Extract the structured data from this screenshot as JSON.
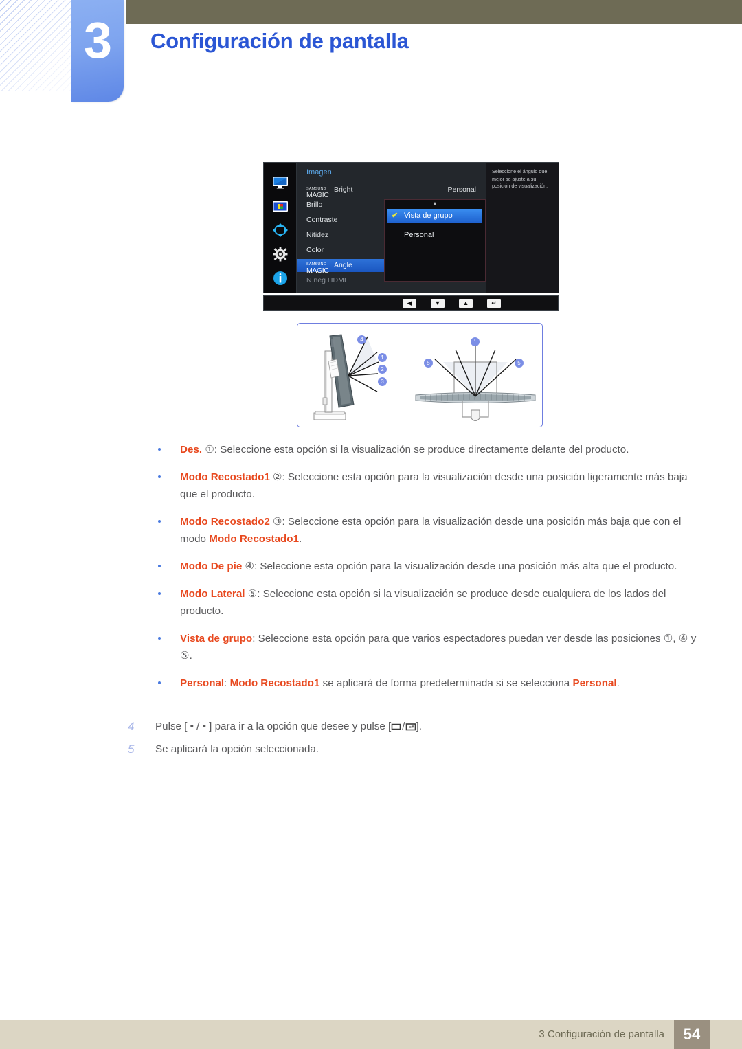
{
  "header": {
    "chapter_number": "3",
    "title": "Configuración de pantalla"
  },
  "osd": {
    "heading": "Imagen",
    "sidebar_icons": [
      "monitor-icon",
      "picture-icon",
      "arrows-icon",
      "gear-icon",
      "info-icon"
    ],
    "menu_items": [
      {
        "samsung": "SAMSUNG",
        "magic": "MAGIC",
        "label": "Bright",
        "state": "normal"
      },
      {
        "label": "Brillo",
        "state": "normal"
      },
      {
        "label": "Contraste",
        "state": "normal"
      },
      {
        "label": "Nitidez",
        "state": "normal"
      },
      {
        "label": "Color",
        "state": "normal"
      },
      {
        "samsung": "SAMSUNG",
        "magic": "MAGIC",
        "label": "Angle",
        "state": "selected"
      },
      {
        "label": "N.neg HDMI",
        "state": "disabled"
      }
    ],
    "bright_value": "Personal",
    "help_text": "Seleccione el ángulo que mejor se ajuste a su posición de visualización.",
    "submenu": {
      "up_arrow": "▲",
      "options": [
        {
          "label": "Vista de grupo",
          "checked": true
        },
        {
          "label": "Personal",
          "checked": false
        }
      ],
      "check_glyph": "✔"
    },
    "toolbar_buttons": [
      {
        "name": "back-button",
        "glyph": "◀"
      },
      {
        "name": "down-button",
        "glyph": "▼"
      },
      {
        "name": "up-button",
        "glyph": "▲"
      },
      {
        "name": "enter-button",
        "glyph": "↵"
      }
    ]
  },
  "diagram": {
    "left_badges": [
      "4",
      "1",
      "2",
      "3"
    ],
    "right_badges": [
      "5",
      "1",
      "5"
    ]
  },
  "bullets": [
    {
      "term": "Des.",
      "circle": "①",
      "rest": ": Seleccione esta opción si la visualización se produce directamente delante del producto."
    },
    {
      "term": "Modo Recostado1",
      "circle": "②",
      "rest": ": Seleccione esta opción para la visualización desde una posición ligeramente más baja que el producto."
    },
    {
      "term": "Modo Recostado2",
      "circle": "③",
      "rest": ": Seleccione esta opción para la visualización desde una posición más baja que con el modo ",
      "rest_term": "Modo Recostado1",
      "rest_tail": "."
    },
    {
      "term": "Modo De pie",
      "circle": "④",
      "rest": ": Seleccione esta opción para la visualización desde una posición más alta que el producto."
    },
    {
      "term": "Modo Lateral",
      "circle": "⑤",
      "rest": ": Seleccione esta opción si la visualización se produce desde cualquiera de los lados del producto."
    },
    {
      "term": "Vista de grupo",
      "circle": "",
      "rest": ": Seleccione esta opción para que varios espectadores puedan ver desde las posiciones ①, ④ y ⑤."
    },
    {
      "term": "Personal",
      "circle": "",
      "rest": ": ",
      "rest_term": "Modo Recostado1",
      "rest_tail": " se aplicará de forma predeterminada si se selecciona ",
      "rest_term2": "Personal",
      "rest_tail2": "."
    }
  ],
  "steps": [
    {
      "number": "4",
      "pre": "Pulse [ • / • ] para ir a la opción que desee y pulse [",
      "post": "].",
      "keys": [
        "menu-key",
        "enter-key"
      ]
    },
    {
      "number": "5",
      "pre": "Se aplicará la opción seleccionada.",
      "post": "",
      "keys": []
    }
  ],
  "footer": {
    "text": "3 Configuración de pantalla",
    "page": "54"
  }
}
